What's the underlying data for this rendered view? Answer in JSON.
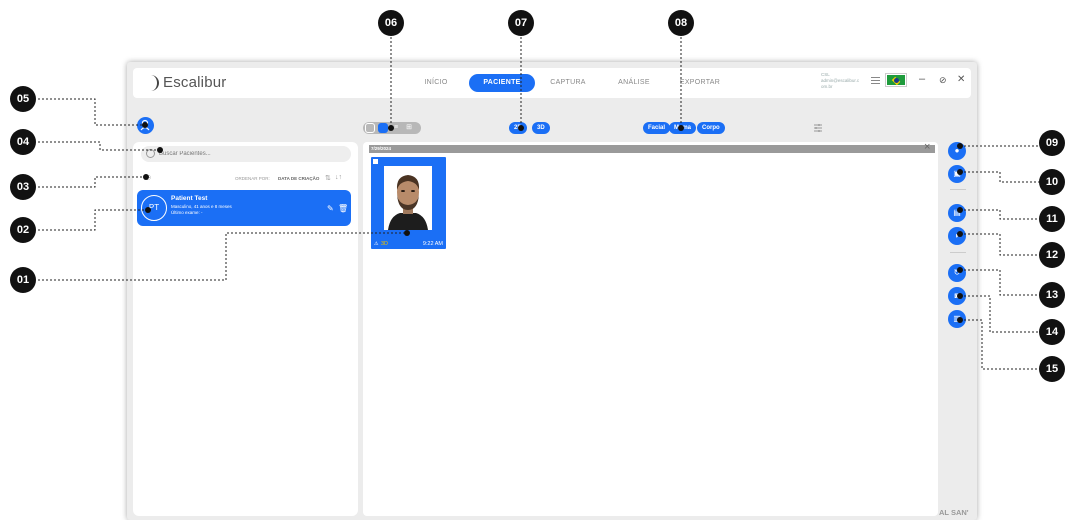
{
  "app": {
    "logo_text": "Escalibur",
    "tabs": [
      "INÍCIO",
      "PACIENTE",
      "CAPTURA",
      "ANÁLISE",
      "EXPORTAR"
    ],
    "active_tab": "PACIENTE",
    "user_line1": "CSL",
    "user_line2": "admin@escalibur.c",
    "user_line3": "om.br",
    "win_minimize": "–",
    "win_restore": "⊘",
    "win_close": "✕"
  },
  "toolbar": {
    "dim_2d": "2D",
    "dim_3d": "3D",
    "filter_facial": "Facial",
    "filter_mama": "Mama",
    "filter_corpo": "Corpo"
  },
  "left": {
    "search_placeholder": "Buscar Pacientes...",
    "sort_label": "ORDENAR POR:",
    "sort_value": "DATA DE CRIAÇÃO",
    "patient": {
      "initials": "PT",
      "name": "Patient Test",
      "info1": "Masculino, 41 anos e 8 meses",
      "info2": "Último exame: -"
    }
  },
  "gallery": {
    "date": "7/29/2024",
    "thumb_tag": "3D",
    "thumb_time": "9:22 AM"
  },
  "watermark": "AL SAN'",
  "callouts": [
    "01",
    "02",
    "03",
    "04",
    "05",
    "06",
    "07",
    "08",
    "09",
    "10",
    "11",
    "12",
    "13",
    "14",
    "15"
  ],
  "colors": {
    "accent": "#1b6ff5",
    "callout": "#111111"
  }
}
